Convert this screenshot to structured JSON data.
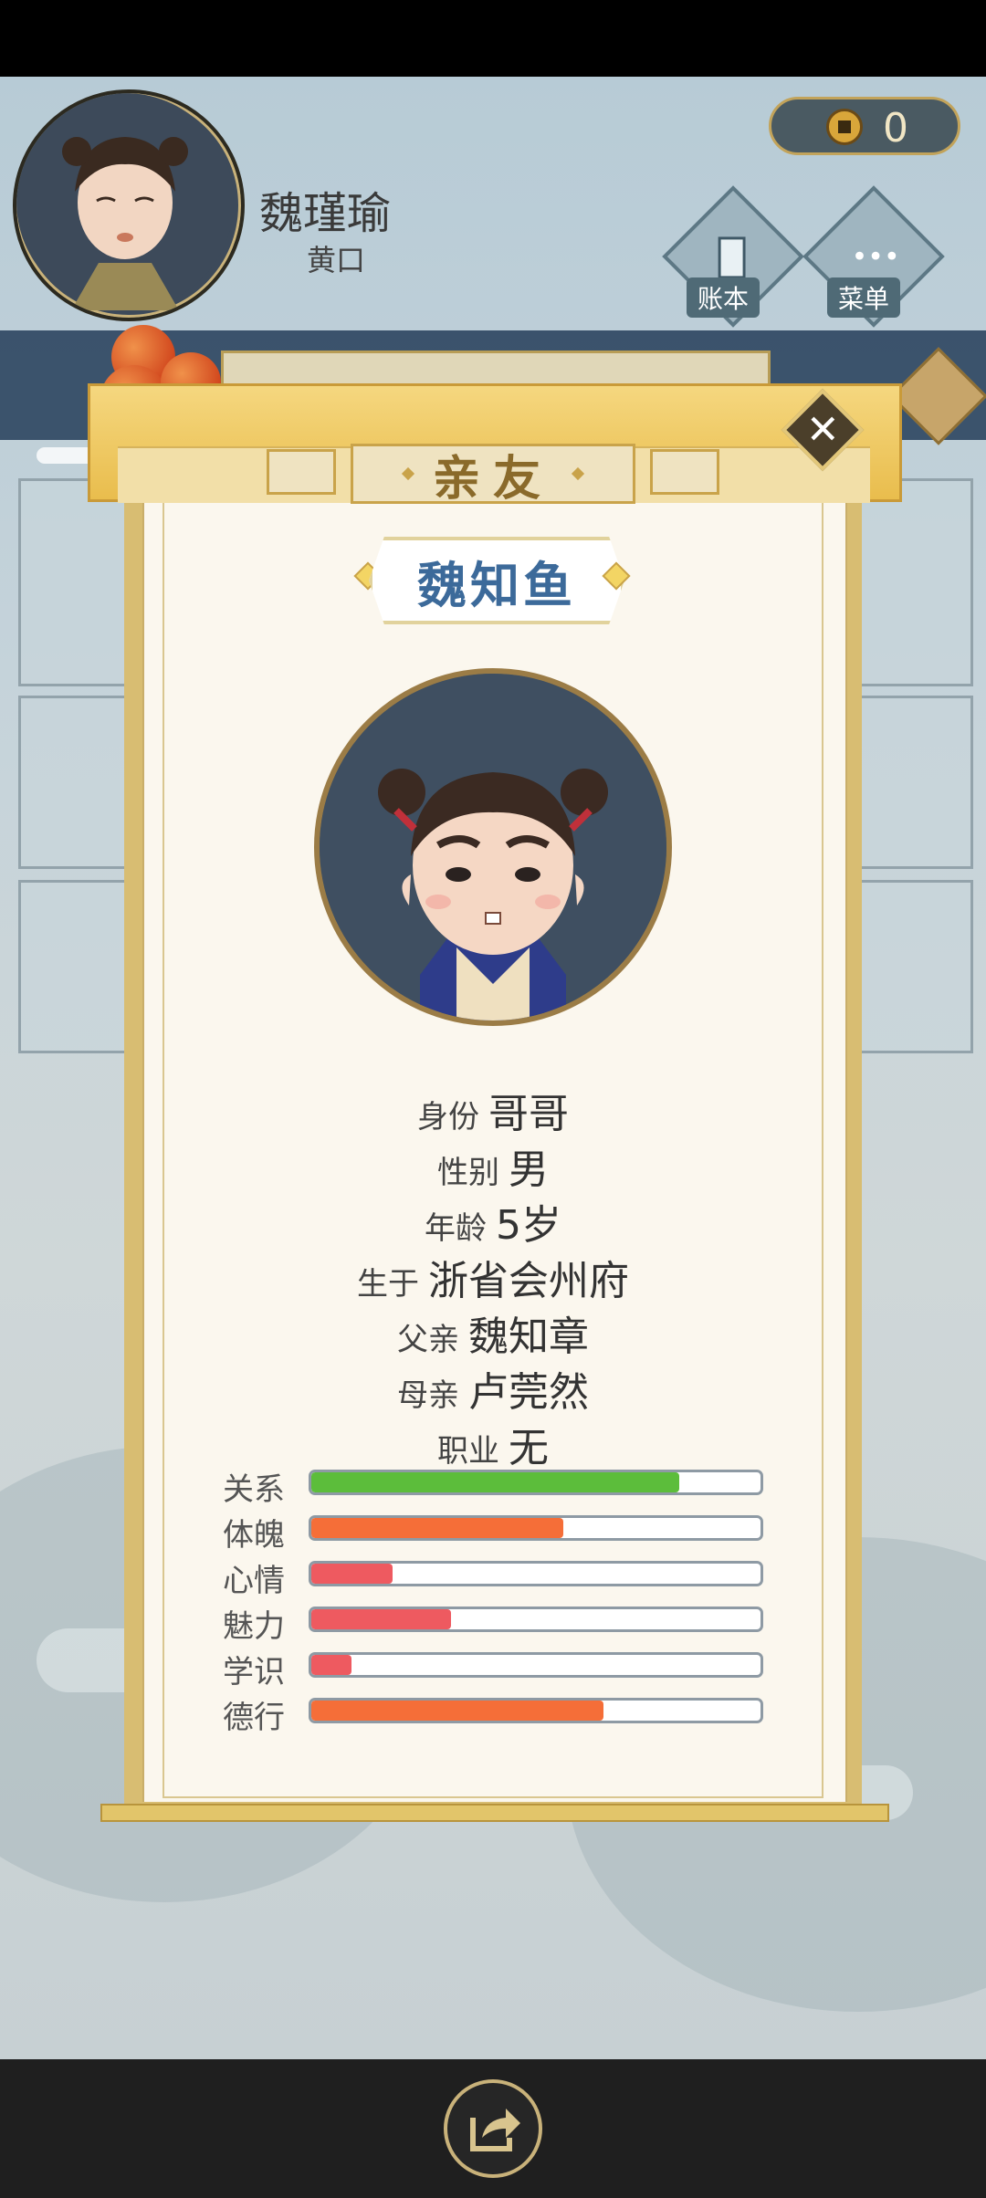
{
  "player": {
    "name": "魏瑾瑜",
    "title": "黄口"
  },
  "currency": {
    "value": "0"
  },
  "menu": {
    "ledger_label": "账本",
    "menu_label": "菜单"
  },
  "dialog": {
    "title": "亲友",
    "name": "魏知鱼",
    "info": [
      {
        "label": "身份",
        "value": "哥哥"
      },
      {
        "label": "性别",
        "value": "男"
      },
      {
        "label": "年龄",
        "value": "5岁"
      },
      {
        "label": "生于",
        "value": "浙省会州府"
      },
      {
        "label": "父亲",
        "value": "魏知章"
      },
      {
        "label": "母亲",
        "value": "卢莞然"
      },
      {
        "label": "职业",
        "value": "无"
      }
    ],
    "stats": [
      {
        "label": "关系",
        "level": 0.82,
        "color": "#5cbd3b"
      },
      {
        "label": "体魄",
        "level": 0.56,
        "color": "#f56e38"
      },
      {
        "label": "心情",
        "level": 0.18,
        "color": "#ee5a60"
      },
      {
        "label": "魅力",
        "level": 0.31,
        "color": "#ee5a60"
      },
      {
        "label": "学识",
        "level": 0.09,
        "color": "#ee5a60"
      },
      {
        "label": "德行",
        "level": 0.65,
        "color": "#f56e38"
      }
    ]
  },
  "colors": {
    "accent_gold": "#e2c56a",
    "name_blue": "#3c6a9a",
    "paper": "#fbf7ee"
  },
  "icons": [
    "coin-icon",
    "ledger-icon",
    "menu-dots-icon",
    "close-icon",
    "share-icon"
  ]
}
